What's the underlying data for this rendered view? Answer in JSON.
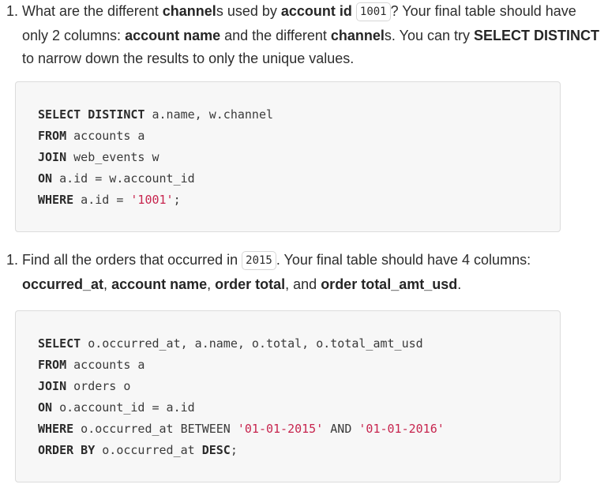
{
  "q1": {
    "number": "1.",
    "segments": [
      {
        "t": "What are the different ",
        "b": false
      },
      {
        "t": "channel",
        "b": true
      },
      {
        "t": "s used by ",
        "b": false
      },
      {
        "t": "account id",
        "b": true
      },
      {
        "t": " ",
        "b": false
      },
      {
        "t": "1001",
        "code": true
      },
      {
        "t": "? Your final table should have only 2 columns: ",
        "b": false
      },
      {
        "t": "account name",
        "b": true
      },
      {
        "t": " and the different ",
        "b": false
      },
      {
        "t": "channel",
        "b": true
      },
      {
        "t": "s. You can try ",
        "b": false
      },
      {
        "t": "SELECT DISTINCT",
        "b": true
      },
      {
        "t": " to narrow down the results to only the unique values.",
        "b": false
      }
    ]
  },
  "code1": [
    [
      {
        "t": "SELECT DISTINCT",
        "k": "kw"
      },
      {
        "t": " a.name, w.channel",
        "k": ""
      }
    ],
    [
      {
        "t": "FROM",
        "k": "kw"
      },
      {
        "t": " accounts a",
        "k": ""
      }
    ],
    [
      {
        "t": "JOIN",
        "k": "kw"
      },
      {
        "t": " web_events w",
        "k": ""
      }
    ],
    [
      {
        "t": "ON",
        "k": "kw"
      },
      {
        "t": " a.id = w.account_id",
        "k": ""
      }
    ],
    [
      {
        "t": "WHERE",
        "k": "kw"
      },
      {
        "t": " a.id = ",
        "k": ""
      },
      {
        "t": "'1001'",
        "k": "str"
      },
      {
        "t": ";",
        "k": ""
      }
    ]
  ],
  "q2": {
    "number": "1.",
    "segments": [
      {
        "t": "Find all the orders that occurred in ",
        "b": false
      },
      {
        "t": "2015",
        "code": true
      },
      {
        "t": ". Your final table should have 4 columns: ",
        "b": false
      },
      {
        "t": "occurred_at",
        "b": true
      },
      {
        "t": ", ",
        "b": false
      },
      {
        "t": "account name",
        "b": true
      },
      {
        "t": ", ",
        "b": false
      },
      {
        "t": "order total",
        "b": true
      },
      {
        "t": ", and ",
        "b": false
      },
      {
        "t": "order total_amt_usd",
        "b": true
      },
      {
        "t": ".",
        "b": false
      }
    ]
  },
  "code2": [
    [
      {
        "t": "SELECT",
        "k": "kw"
      },
      {
        "t": " o.occurred_at, a.name, o.total, o.total_amt_usd",
        "k": ""
      }
    ],
    [
      {
        "t": "FROM",
        "k": "kw"
      },
      {
        "t": " accounts a",
        "k": ""
      }
    ],
    [
      {
        "t": "JOIN",
        "k": "kw"
      },
      {
        "t": " orders o",
        "k": ""
      }
    ],
    [
      {
        "t": "ON",
        "k": "kw"
      },
      {
        "t": " o.account_id = a.id",
        "k": ""
      }
    ],
    [
      {
        "t": "WHERE",
        "k": "kw"
      },
      {
        "t": " o.occurred_at BETWEEN ",
        "k": ""
      },
      {
        "t": "'01-01-2015'",
        "k": "str"
      },
      {
        "t": " AND ",
        "k": ""
      },
      {
        "t": "'01-01-2016'",
        "k": "str"
      }
    ],
    [
      {
        "t": "ORDER BY",
        "k": "kw"
      },
      {
        "t": " o.occurred_at ",
        "k": ""
      },
      {
        "t": "DESC",
        "k": "kw"
      },
      {
        "t": ";",
        "k": ""
      }
    ]
  ]
}
